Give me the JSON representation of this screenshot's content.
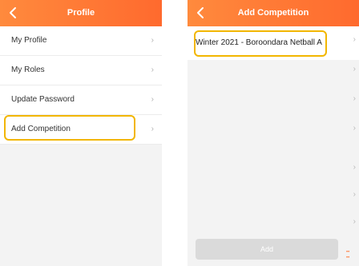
{
  "left": {
    "header": {
      "title": "Profile"
    },
    "items": [
      {
        "label": "My Profile"
      },
      {
        "label": "My Roles"
      },
      {
        "label": "Update Password"
      },
      {
        "label": "Add Competition"
      }
    ],
    "chevron": "›"
  },
  "right": {
    "header": {
      "title": "Add Competition"
    },
    "competition": {
      "label": "Winter 2021 - Boroondara Netball A"
    },
    "chevron": "›",
    "add_button": "Add"
  },
  "colors": {
    "header": "#ff7a35",
    "highlight": "#f2b600",
    "background": "#f3f3f3"
  }
}
